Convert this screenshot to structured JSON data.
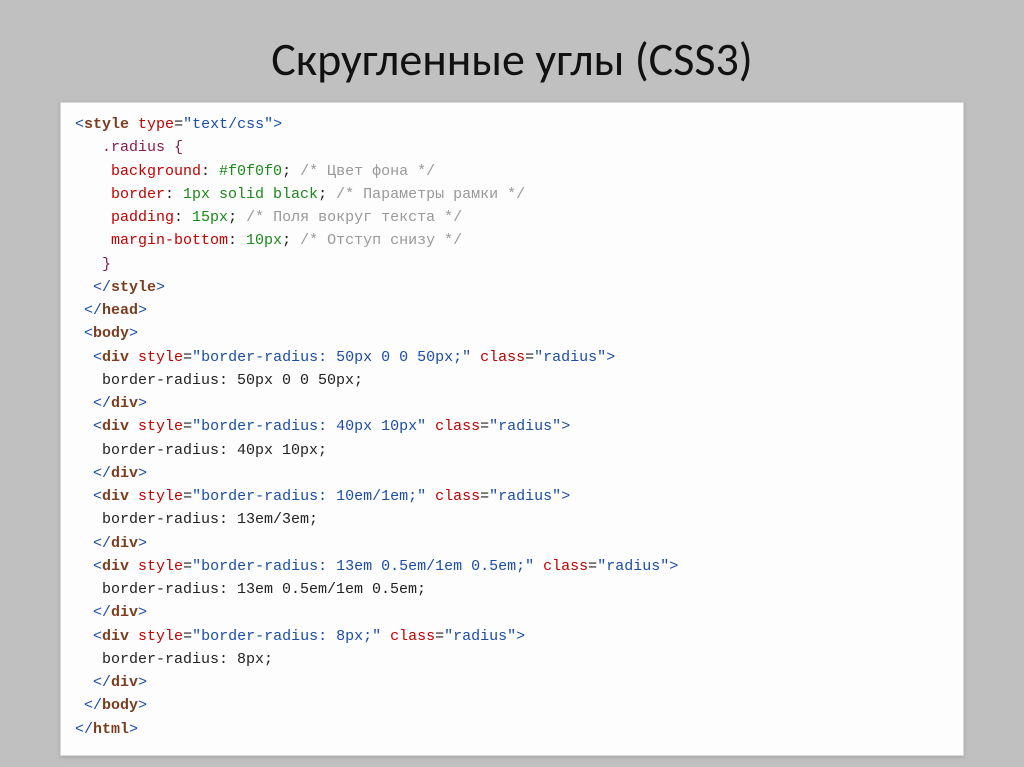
{
  "title": "Скругленные углы (CSS3)",
  "code": {
    "l1_open": "<",
    "l1_tag": "style",
    "l1_sp": " ",
    "l1_attr": "type",
    "l1_eq": "=",
    "l1_val": "\"text/css\"",
    "l1_close": ">",
    "l2_sel": "   .radius {",
    "l3_prop": "    background",
    "l3_colon": ": ",
    "l3_val": "#f0f0f0",
    "l3_semi": "; ",
    "l3_comment": "/* Цвет фона */",
    "l4_prop": "    border",
    "l4_colon": ": ",
    "l4_val": "1px solid black",
    "l4_semi": "; ",
    "l4_comment": "/* Параметры рамки */",
    "l5_prop": "    padding",
    "l5_colon": ": ",
    "l5_val": "15px",
    "l5_semi": "; ",
    "l5_comment": "/* Поля вокруг текста */",
    "l6_prop": "    margin-bottom",
    "l6_colon": ": ",
    "l6_val": "10px",
    "l6_semi": "; ",
    "l6_comment": "/* Отступ снизу */",
    "l7_close": "   }",
    "l8_open": "  </",
    "l8_tag": "style",
    "l8_close": ">",
    "l9_open": " </",
    "l9_tag": "head",
    "l9_close": ">",
    "l10_open": " <",
    "l10_tag": "body",
    "l10_close": ">",
    "div1_open": "  <",
    "div1_tag": "div",
    "div1_sp": " ",
    "div1_a1": "style",
    "div1_eq1": "=",
    "div1_v1": "\"border-radius: 50px 0 0 50px;\"",
    "div1_sp2": " ",
    "div1_a2": "class",
    "div1_eq2": "=",
    "div1_v2": "\"radius\"",
    "div1_close": ">",
    "div1_text": "   border-radius: 50px 0 0 50px;",
    "div1_end_o": "  </",
    "div1_end_t": "div",
    "div1_end_c": ">",
    "div2_open": "  <",
    "div2_tag": "div",
    "div2_sp": " ",
    "div2_a1": "style",
    "div2_eq1": "=",
    "div2_v1": "\"border-radius: 40px 10px\"",
    "div2_sp2": " ",
    "div2_a2": "class",
    "div2_eq2": "=",
    "div2_v2": "\"radius\"",
    "div2_close": ">",
    "div2_text": "   border-radius: 40px 10px;",
    "div2_end_o": "  </",
    "div2_end_t": "div",
    "div2_end_c": ">",
    "div3_open": "  <",
    "div3_tag": "div",
    "div3_sp": " ",
    "div3_a1": "style",
    "div3_eq1": "=",
    "div3_v1": "\"border-radius: 10em/1em;\"",
    "div3_sp2": " ",
    "div3_a2": "class",
    "div3_eq2": "=",
    "div3_v2": "\"radius\"",
    "div3_close": ">",
    "div3_text": "   border-radius: 13em/3em;",
    "div3_end_o": "  </",
    "div3_end_t": "div",
    "div3_end_c": ">",
    "div4_open": "  <",
    "div4_tag": "div",
    "div4_sp": " ",
    "div4_a1": "style",
    "div4_eq1": "=",
    "div4_v1": "\"border-radius: 13em 0.5em/1em 0.5em;\"",
    "div4_sp2": " ",
    "div4_a2": "class",
    "div4_eq2": "=",
    "div4_v2": "\"radius\"",
    "div4_close": ">",
    "div4_text": "   border-radius: 13em 0.5em/1em 0.5em;",
    "div4_end_o": "  </",
    "div4_end_t": "div",
    "div4_end_c": ">",
    "div5_open": "  <",
    "div5_tag": "div",
    "div5_sp": " ",
    "div5_a1": "style",
    "div5_eq1": "=",
    "div5_v1": "\"border-radius: 8px;\"",
    "div5_sp2": " ",
    "div5_a2": "class",
    "div5_eq2": "=",
    "div5_v2": "\"radius\"",
    "div5_close": ">",
    "div5_text": "   border-radius: 8px;",
    "div5_end_o": "  </",
    "div5_end_t": "div",
    "div5_end_c": ">",
    "body_end_o": " </",
    "body_end_t": "body",
    "body_end_c": ">",
    "html_end_o": "</",
    "html_end_t": "html",
    "html_end_c": ">"
  }
}
